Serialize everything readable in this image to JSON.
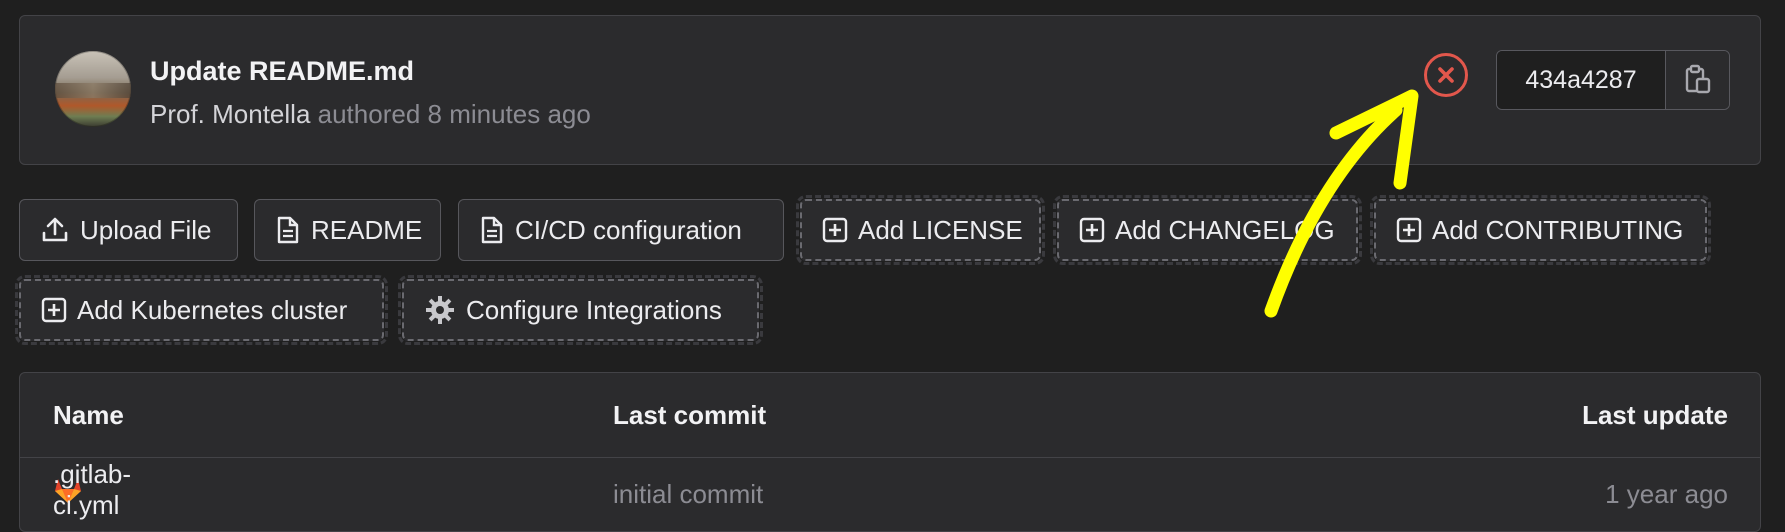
{
  "commit": {
    "title": "Update README.md",
    "author": "Prof. Montella",
    "meta": "authored 8 minutes ago",
    "pipeline_status": "failed",
    "sha": "434a4287"
  },
  "actions": [
    {
      "label": "Upload File",
      "icon": "upload-icon"
    },
    {
      "label": "README",
      "icon": "file-icon"
    },
    {
      "label": "CI/CD configuration",
      "icon": "file-icon"
    },
    {
      "label": "Add LICENSE",
      "icon": "plus-square-icon"
    },
    {
      "label": "Add CHANGELOG",
      "icon": "plus-square-icon"
    },
    {
      "label": "Add CONTRIBUTING",
      "icon": "plus-square-icon"
    },
    {
      "label": "Add Kubernetes cluster",
      "icon": "plus-square-icon"
    },
    {
      "label": "Configure Integrations",
      "icon": "gear-icon"
    }
  ],
  "files_table": {
    "headers": [
      "Name",
      "Last commit",
      "Last update"
    ],
    "rows": [
      {
        "name": ".gitlab-ci.yml",
        "last_commit": "initial commit",
        "last_update": "1 year ago",
        "icon": "gitlab-icon"
      }
    ]
  },
  "colors": {
    "background": "#1f1f1f",
    "panel": "#2b2b2d",
    "status_failed": "#e2574c",
    "annotation_arrow": "#ffff00"
  }
}
